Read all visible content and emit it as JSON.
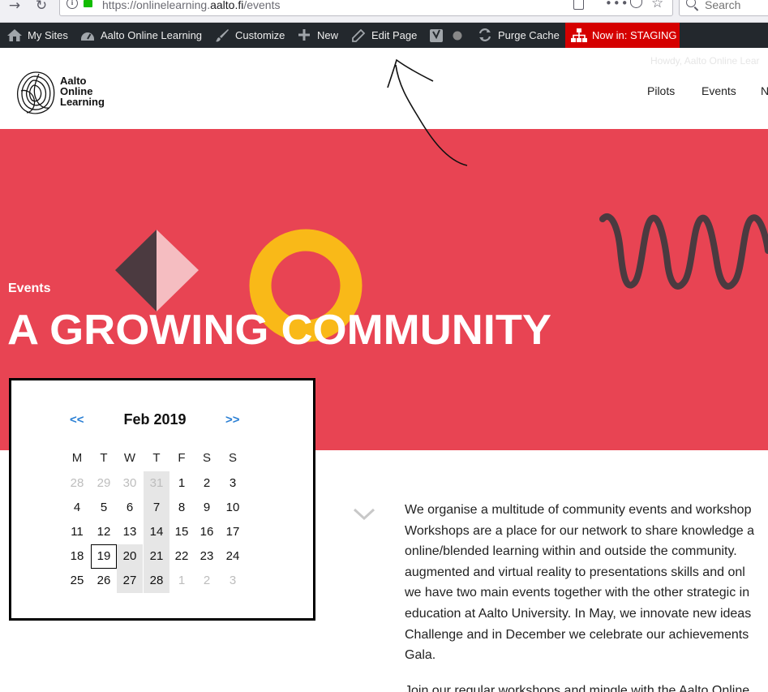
{
  "browser": {
    "url_prefix": "https://onlinelearning.",
    "url_host": "aalto.fi",
    "url_path": "/events",
    "search_placeholder": "Search",
    "icons": [
      "back-icon",
      "forward-icon",
      "reload-icon",
      "info-icon",
      "lock-icon",
      "reader-view-icon",
      "more-icon",
      "pocket-icon",
      "bookmark-star-icon",
      "search-icon"
    ]
  },
  "adminbar": {
    "my_sites": "My Sites",
    "site_name": "Aalto Online Learning",
    "customize": "Customize",
    "new": "New",
    "edit_page": "Edit Page",
    "purge_cache": "Purge Cache",
    "staging": "Now in: STAGING",
    "colors": {
      "background": "#23282d",
      "staging": "#d50000"
    }
  },
  "header": {
    "logo_lines": [
      "Aalto",
      "Online",
      "Learning"
    ],
    "howdy": "Howdy, Aalto Online Lear",
    "nav": [
      "Pilots",
      "Events",
      "N"
    ]
  },
  "hero": {
    "label": "Events",
    "title": "A GROWING COMMUNITY",
    "colors": {
      "background": "#e84453",
      "ring": "#f9b918",
      "dark": "#4b3a40",
      "pink": "#f5bdc1"
    }
  },
  "calendar": {
    "prev": "<<",
    "next": ">>",
    "month": "Feb 2019",
    "weekdays": [
      "M",
      "T",
      "W",
      "T",
      "F",
      "S",
      "S"
    ],
    "weeks": [
      [
        "28",
        "29",
        "30",
        "31",
        "1",
        "2",
        "3"
      ],
      [
        "4",
        "5",
        "6",
        "7",
        "8",
        "9",
        "10"
      ],
      [
        "11",
        "12",
        "13",
        "14",
        "15",
        "16",
        "17"
      ],
      [
        "18",
        "19",
        "20",
        "21",
        "22",
        "23",
        "24"
      ],
      [
        "25",
        "26",
        "27",
        "28",
        "1",
        "2",
        "3"
      ]
    ],
    "today": "19"
  },
  "content": {
    "paragraph_lines": [
      "We organise a multitude of community events and workshop",
      "Workshops are a place for our network to share knowledge a",
      "online/blended learning within and outside the community. ",
      "augmented and virtual reality to presentations skills and onl",
      "we have two main events together with the other strategic in",
      "education at Aalto University. In May, we innovate new ideas",
      "Challenge and in December we celebrate our achievements",
      "Gala."
    ],
    "second_line": "Join our regular workshops and mingle with the Aalto Online"
  }
}
